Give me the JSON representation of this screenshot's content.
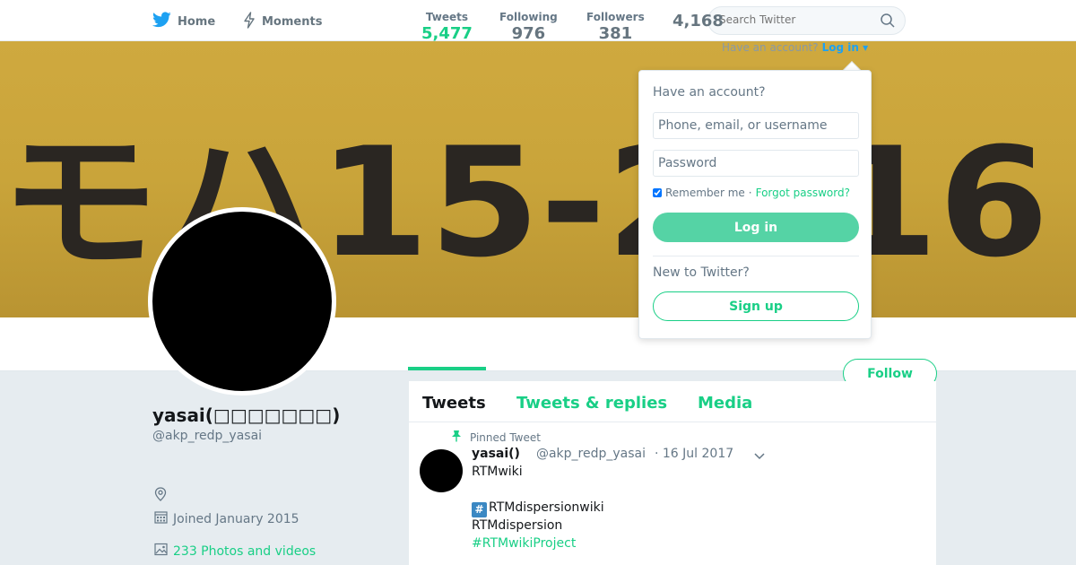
{
  "nav": {
    "home_label": "Home",
    "moments_label": "Moments",
    "search_placeholder": "Search Twitter"
  },
  "banner": {
    "plate_text": "モハ15-2016"
  },
  "account_prompt": {
    "text": "Have an account?",
    "login_label": "Log in"
  },
  "stats": [
    {
      "label": "Tweets",
      "value": "5,477"
    },
    {
      "label": "Following",
      "value": "976"
    },
    {
      "label": "Followers",
      "value": "381"
    },
    {
      "label": "",
      "value": "4,168"
    }
  ],
  "follow_label": "Follow",
  "profile": {
    "name": "yasai(□□□□□□□)",
    "handle": "@akp_redp_yasai",
    "joined": "Joined January 2015",
    "photos": "233 Photos and videos"
  },
  "timeline": {
    "tabs": [
      "Tweets",
      "Tweets & replies",
      "Media"
    ]
  },
  "tweet": {
    "pinned_label": "Pinned Tweet",
    "name": "yasai()",
    "handle": "@akp_redp_yasai",
    "date": "· 16 Jul 2017",
    "lines": [
      "RTMwiki",
      "RTMdispersionwiki",
      "RTMdispersion",
      "#RTMwikiProject"
    ],
    "hash_emoji": "#"
  },
  "login_dropdown": {
    "heading": "Have an account?",
    "username_placeholder": "Phone, email, or username",
    "password_placeholder": "Password",
    "remember_label": "Remember me",
    "separator": "·",
    "forgot_label": "Forgot password?",
    "login_button": "Log in",
    "new_heading": "New to Twitter?",
    "signup_button": "Sign up"
  },
  "colors": {
    "accent": "#19cf86",
    "twitter_blue": "#1da1f2",
    "banner": "#c9a43b"
  }
}
